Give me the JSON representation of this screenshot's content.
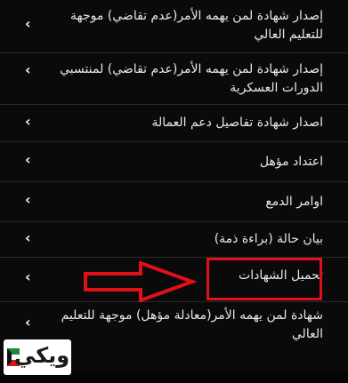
{
  "menu": {
    "items": [
      {
        "label_line1": "إصدار شهادة لمن يهمه الأمر(عدم تقاضي) موجهة",
        "label_line2": "للتعليم العالي"
      },
      {
        "label_line1": "إصدار شهادة لمن يهمه الأمر(عدم تقاضي) لمنتسبي",
        "label_line2": "الدورات العسكرية"
      },
      {
        "label_line1": "اصدار شهادة تفاصيل دعم العمالة",
        "label_line2": ""
      },
      {
        "label_line1": "اعتداد مؤهل",
        "label_line2": ""
      },
      {
        "label_line1": "اوامر الدمع",
        "label_line2": ""
      },
      {
        "label_line1": "بيان حالة (براءة ذمة)",
        "label_line2": ""
      },
      {
        "label_line1": "تحميل الشهادات",
        "label_line2": ""
      },
      {
        "label_line1": "شهادة لمن يهمه الأمر(معادلة مؤهل) موجهة للتعليم",
        "label_line2": "العالي"
      }
    ],
    "chevron_icon": "chevron-left-icon"
  },
  "annotation": {
    "highlight_color": "#e0101a",
    "arrow_icon": "red-arrow-right-icon"
  },
  "watermark": {
    "text": "ويكي"
  },
  "colors": {
    "background": "#0a0a0a",
    "text": "#e8e8e8",
    "divider": "#2a2a2a"
  }
}
